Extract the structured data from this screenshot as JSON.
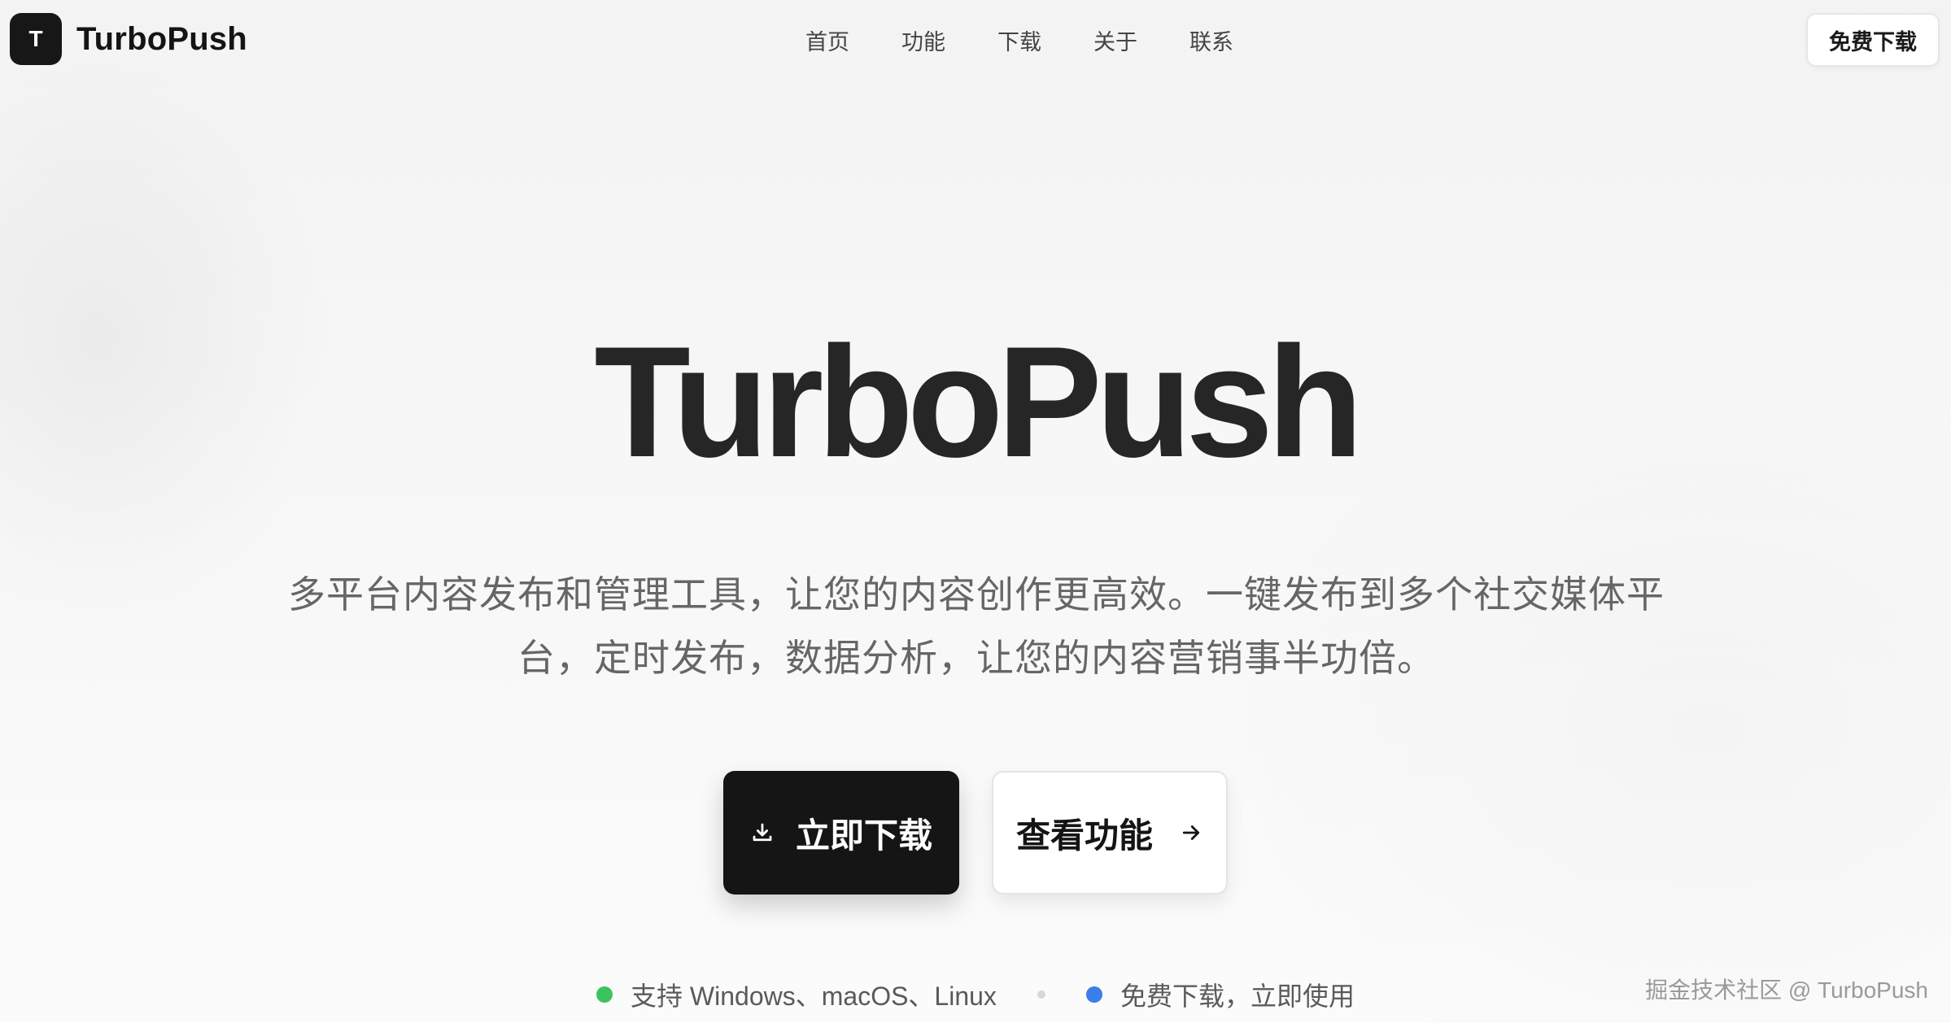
{
  "header": {
    "brand": {
      "logo_letter": "T",
      "name": "TurboPush"
    },
    "nav": [
      "首页",
      "功能",
      "下载",
      "关于",
      "联系"
    ],
    "cta_label": "免费下载"
  },
  "hero": {
    "title": "TurboPush",
    "subtitle_line1": "多平台内容发布和管理工具，让您的内容创作更高效。一键发布到多个社交媒体平",
    "subtitle_line2": "台，定时发布，数据分析，让您的内容营销事半功倍。",
    "primary_button": {
      "label": "立即下载",
      "icon": "download-icon"
    },
    "secondary_button": {
      "label": "查看功能",
      "icon": "arrow-right-icon"
    }
  },
  "features": [
    {
      "label": "支持 Windows、macOS、Linux",
      "dot_color": "#3cc35f"
    },
    {
      "label": "免费下载，立即使用",
      "dot_color": "#3b7de9"
    }
  ],
  "watermark": "掘金技术社区 @ TurboPush",
  "colors": {
    "dark": "#151515",
    "text_muted": "#666666",
    "green": "#3cc35f",
    "blue": "#3b7de9"
  }
}
